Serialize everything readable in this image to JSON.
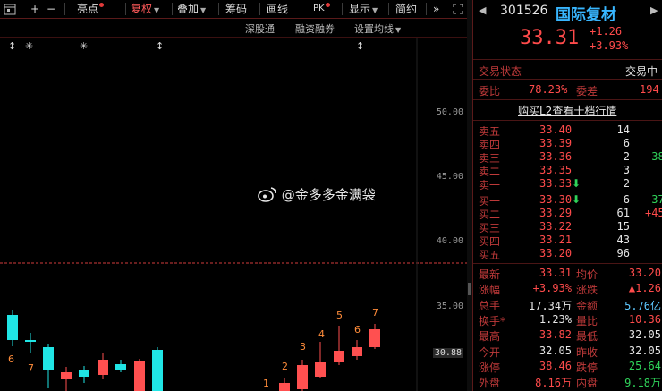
{
  "toolbar": {
    "items": [
      {
        "label": "亮点",
        "dot": true
      },
      {
        "label": "复权",
        "dot": true,
        "dropdown": true,
        "active": true
      },
      {
        "label": "叠加",
        "dropdown": true
      },
      {
        "label": "筹码"
      },
      {
        "label": "画线"
      },
      {
        "label": "PK",
        "dot": true
      },
      {
        "label": "显示",
        "dropdown": true
      },
      {
        "label": "简约"
      }
    ],
    "glyph_plus": "+",
    "glyph_minus": "−",
    "glyph_more": "»"
  },
  "subbar": {
    "items": [
      "深股通",
      "融资融券",
      "设置均线"
    ]
  },
  "chart": {
    "yticks": [
      "50.00",
      "45.00",
      "40.00",
      "35.00",
      "30.88"
    ],
    "markers": [
      "↕",
      "✳",
      "✳",
      "↕",
      "↕"
    ],
    "candle_labels": [
      "6",
      "7",
      "1",
      "2",
      "3",
      "4",
      "5",
      "6",
      "7"
    ],
    "dashed_line_color": "#d23b3b",
    "up_color": "#ff5050",
    "down_color": "#20e6e6"
  },
  "watermark": "@金多多金满袋",
  "quote": {
    "code": "301526",
    "name": "国际复材",
    "price": "33.31",
    "change": "+1.26",
    "change_pct": "+3.93%"
  },
  "status": {
    "label": "交易状态",
    "value": "交易中"
  },
  "ratio": {
    "label1": "委比",
    "value1": "78.23%",
    "label2": "委差",
    "value2": "194"
  },
  "l2_link": "购买L2查看十档行情",
  "asks": [
    {
      "label": "卖五",
      "price": "33.40",
      "vol": "14",
      "extra": ""
    },
    {
      "label": "卖四",
      "price": "33.39",
      "vol": "6",
      "extra": ""
    },
    {
      "label": "卖三",
      "price": "33.36",
      "vol": "2",
      "extra": "-38"
    },
    {
      "label": "卖二",
      "price": "33.35",
      "vol": "3",
      "extra": ""
    },
    {
      "label": "卖一",
      "price": "33.33",
      "vol": "2",
      "extra": "",
      "arrow": "⬇"
    }
  ],
  "bids": [
    {
      "label": "买一",
      "price": "33.30",
      "vol": "6",
      "extra": "-37",
      "arrow": "⬇"
    },
    {
      "label": "买二",
      "price": "33.29",
      "vol": "61",
      "extra": "+45"
    },
    {
      "label": "买三",
      "price": "33.22",
      "vol": "15",
      "extra": ""
    },
    {
      "label": "买四",
      "price": "33.21",
      "vol": "43",
      "extra": ""
    },
    {
      "label": "买五",
      "price": "33.20",
      "vol": "96",
      "extra": ""
    }
  ],
  "stats": [
    {
      "l1": "最新",
      "v1": "33.31",
      "c1": "red",
      "l2": "均价",
      "v2": "33.20",
      "c2": "red"
    },
    {
      "l1": "涨幅",
      "v1": "+3.93%",
      "c1": "red",
      "l2": "涨跌",
      "v2": "▲1.26",
      "c2": "red"
    },
    {
      "l1": "总手",
      "v1": "17.34万",
      "c1": "white",
      "l2": "金额",
      "v2": "5.76亿",
      "c2": "cyan"
    },
    {
      "l1": "换手*",
      "v1": "1.23%",
      "c1": "white",
      "l2": "量比",
      "v2": "10.36",
      "c2": "red"
    },
    {
      "l1": "最高",
      "v1": "33.82",
      "c1": "red",
      "l2": "最低",
      "v2": "32.05",
      "c2": "white"
    },
    {
      "l1": "今开",
      "v1": "32.05",
      "c1": "white",
      "l2": "昨收",
      "v2": "32.05",
      "c2": "white"
    },
    {
      "l1": "涨停",
      "v1": "38.46",
      "c1": "red",
      "l2": "跌停",
      "v2": "25.64",
      "c2": "green"
    },
    {
      "l1": "外盘",
      "v1": "8.16万",
      "c1": "red",
      "l2": "内盘",
      "v2": "9.18万",
      "c2": "green"
    }
  ]
}
